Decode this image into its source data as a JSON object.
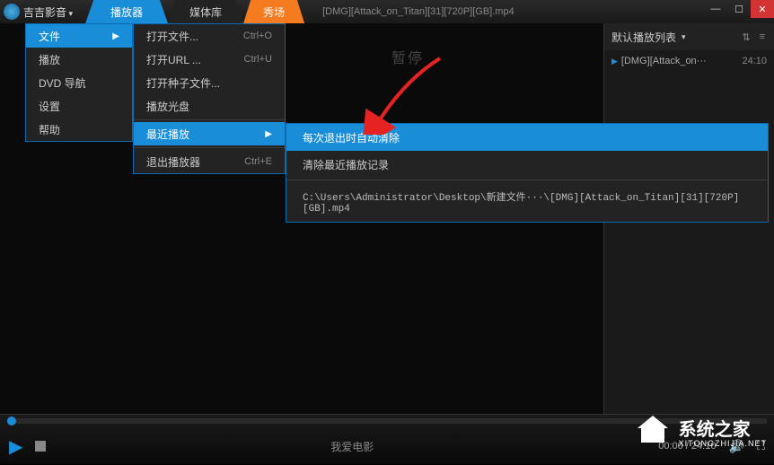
{
  "app": {
    "name": "吉吉影音"
  },
  "tabs": {
    "player": "播放器",
    "library": "媒体库",
    "show": "秀场"
  },
  "title": "[DMG][Attack_on_Titan][31][720P][GB].mp4",
  "menu1": {
    "file": "文件",
    "play": "播放",
    "dvd": "DVD 导航",
    "settings": "设置",
    "help": "帮助"
  },
  "menu2": {
    "open_file": "打开文件...",
    "open_file_sc": "Ctrl+O",
    "open_url": "打开URL ...",
    "open_url_sc": "Ctrl+U",
    "open_torrent": "打开种子文件...",
    "play_disc": "播放光盘",
    "recent": "最近播放",
    "exit": "退出播放器",
    "exit_sc": "Ctrl+E"
  },
  "menu3": {
    "auto_clear": "每次退出时自动清除",
    "clear_recent": "清除最近播放记录",
    "recent_path": "C:\\Users\\Administrator\\Desktop\\新建文件···\\[DMG][Attack_on_Titan][31][720P][GB].mp4"
  },
  "playlist": {
    "header": "默认播放列表",
    "items": [
      {
        "name": "[DMG][Attack_on···",
        "duration": "24:10"
      }
    ]
  },
  "watermark_text": "暂停",
  "controls": {
    "center_text": "我爱电影",
    "time": "00:00 / 24:10"
  },
  "site_watermark": {
    "cn": "系统之家",
    "en": "XITONGZHIJIA.NET"
  }
}
